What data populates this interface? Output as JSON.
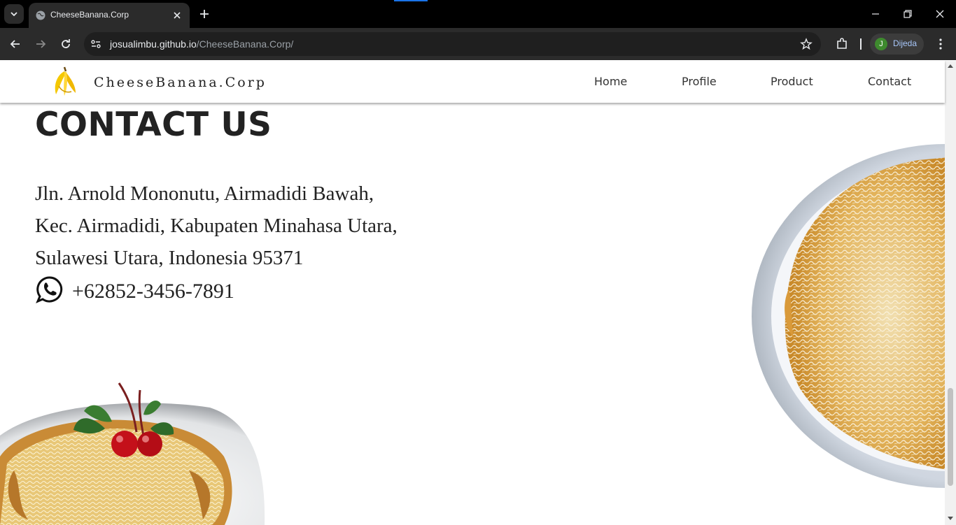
{
  "browser": {
    "tab_title": "CheeseBanana.Corp",
    "url_host": "josualimbu.github.io",
    "url_path": "/CheeseBanana.Corp/",
    "profile_initial": "J",
    "profile_name": "Dijeda"
  },
  "site": {
    "brand": "CheeseBanana.Corp",
    "nav": [
      "Home",
      "Profile",
      "Product",
      "Contact"
    ]
  },
  "contact": {
    "title": "CONTACT US",
    "address_lines": [
      "Jln. Arnold Mononutu, Airmadidi Bawah,",
      "Kec. Airmadidi, Kabupaten Minahasa Utara,",
      "Sulawesi Utara, Indonesia 95371"
    ],
    "phone": "+62852-3456-7891"
  },
  "colors": {
    "chrome_bg": "#000000",
    "toolbar_bg": "#2b2b2b",
    "logo_yellow": "#f5c800",
    "text_dark": "#222222"
  },
  "icons": [
    "tab-search-icon",
    "globe-icon",
    "close-icon",
    "plus-icon",
    "minimize-icon",
    "restore-icon",
    "back-icon",
    "forward-icon",
    "reload-icon",
    "site-settings-icon",
    "star-icon",
    "extensions-icon",
    "kebab-menu-icon",
    "banana-logo-icon",
    "whatsapp-icon"
  ]
}
